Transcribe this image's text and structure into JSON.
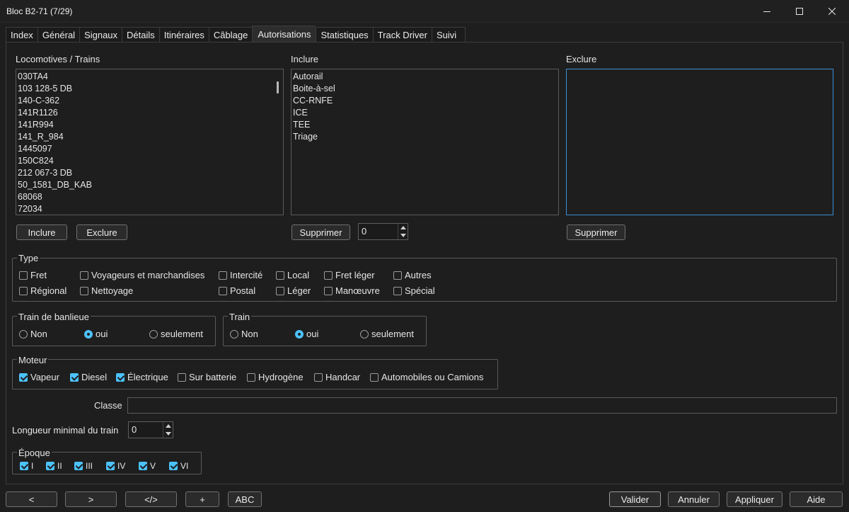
{
  "window": {
    "title": "Bloc B2-71 (7/29)"
  },
  "tabs": [
    "Index",
    "Général",
    "Signaux",
    "Détails",
    "Itinéraires",
    "Câblage",
    "Autorisations",
    "Statistiques",
    "Track Driver",
    "Suivi"
  ],
  "active_tab": "Autorisations",
  "locos": {
    "label": "Locomotives / Trains",
    "items": [
      "030TA4",
      "103 128-5 DB",
      "140-C-362",
      "141R1126",
      "141R994",
      "141_R_984",
      "1445097",
      "150C824",
      "212 067-3 DB",
      "50_1581_DB_KAB",
      "68068",
      "72034"
    ],
    "btn_include": "Inclure",
    "btn_exclude": "Exclure"
  },
  "include": {
    "label": "Inclure",
    "items": [
      "Autorail",
      "Boite-à-sel",
      "CC-RNFE",
      "ICE",
      "TEE",
      "Triage"
    ],
    "btn_delete": "Supprimer",
    "spin_value": "0"
  },
  "exclude": {
    "label": "Exclure",
    "items": [],
    "btn_delete": "Supprimer"
  },
  "type_group": {
    "title": "Type",
    "items": [
      {
        "label": "Fret",
        "checked": false
      },
      {
        "label": "Voyageurs et marchandises",
        "checked": false
      },
      {
        "label": "Intercité",
        "checked": false
      },
      {
        "label": "Local",
        "checked": false
      },
      {
        "label": "Fret léger",
        "checked": false
      },
      {
        "label": "Autres",
        "checked": false
      },
      {
        "label": "Régional",
        "checked": false
      },
      {
        "label": "Nettoyage",
        "checked": false
      },
      {
        "label": "Postal",
        "checked": false
      },
      {
        "label": "Léger",
        "checked": false
      },
      {
        "label": "Manœuvre",
        "checked": false
      },
      {
        "label": "Spécial",
        "checked": false
      }
    ]
  },
  "suburban": {
    "title": "Train de banlieue",
    "options": [
      "Non",
      "oui",
      "seulement"
    ],
    "selected": "oui"
  },
  "train": {
    "title": "Train",
    "options": [
      "Non",
      "oui",
      "seulement"
    ],
    "selected": "oui"
  },
  "motor": {
    "title": "Moteur",
    "items": [
      {
        "label": "Vapeur",
        "checked": true
      },
      {
        "label": "Diesel",
        "checked": true
      },
      {
        "label": "Électrique",
        "checked": true
      },
      {
        "label": "Sur batterie",
        "checked": false
      },
      {
        "label": "Hydrogène",
        "checked": false
      },
      {
        "label": "Handcar",
        "checked": false
      },
      {
        "label": "Automobiles ou Camions",
        "checked": false
      }
    ]
  },
  "classe": {
    "label": "Classe",
    "value": ""
  },
  "min_length": {
    "label": "Longueur minimal du train",
    "value": "0"
  },
  "epoch": {
    "title": "Époque",
    "items": [
      {
        "label": "I",
        "checked": true
      },
      {
        "label": "II",
        "checked": true
      },
      {
        "label": "III",
        "checked": true
      },
      {
        "label": "IV",
        "checked": true
      },
      {
        "label": "V",
        "checked": true
      },
      {
        "label": "VI",
        "checked": true
      }
    ]
  },
  "bottom_left": [
    "<",
    ">",
    "</>",
    "+",
    "ABC"
  ],
  "bottom_right": [
    "Valider",
    "Annuler",
    "Appliquer",
    "Aide"
  ],
  "colors": {
    "accent": "#4cc2ff",
    "focus_border": "#3b8fd6",
    "background": "#1e1e1e"
  }
}
